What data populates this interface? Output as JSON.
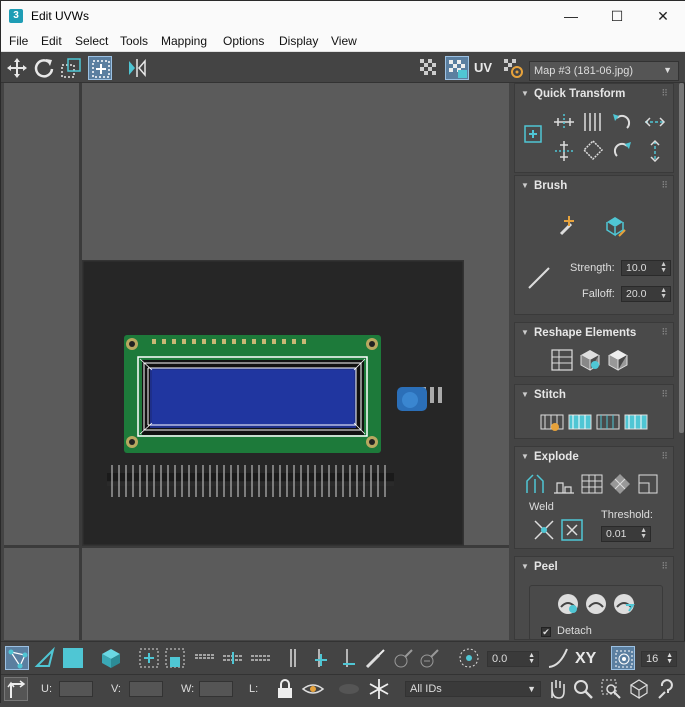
{
  "window": {
    "app_icon_text": "3",
    "title": "Edit UVWs",
    "minimize": "—",
    "maximize": "☐",
    "close": "✕"
  },
  "menus": [
    "File",
    "Edit",
    "Select",
    "Tools",
    "Mapping",
    "Options",
    "Display",
    "View"
  ],
  "toolbar": {
    "uv_label": "UV",
    "map_select": "Map #3 (181-06.jpg)"
  },
  "panel": {
    "quick_transform": {
      "title": "Quick Transform"
    },
    "brush": {
      "title": "Brush",
      "strength_label": "Strength:",
      "strength_value": "10.0",
      "falloff_label": "Falloff:",
      "falloff_value": "20.0"
    },
    "reshape": {
      "title": "Reshape Elements"
    },
    "stitch": {
      "title": "Stitch"
    },
    "explode": {
      "title": "Explode",
      "weld_label": "Weld",
      "threshold_label": "Threshold:",
      "threshold_value": "0.01"
    },
    "peel": {
      "title": "Peel",
      "detach_label": "Detach"
    }
  },
  "bottom": {
    "spinner_value": "0.0",
    "xy_label": "XY",
    "zoom_value": "16",
    "u_label": "U:",
    "v_label": "V:",
    "w_label": "W:",
    "l_label": "L:",
    "ids_select": "All IDs"
  },
  "colors": {
    "accent": "#4fc6d4",
    "panel_bg": "#444444",
    "viewport_bg": "#5b5b5b",
    "uv_edges": "#ffffff"
  }
}
